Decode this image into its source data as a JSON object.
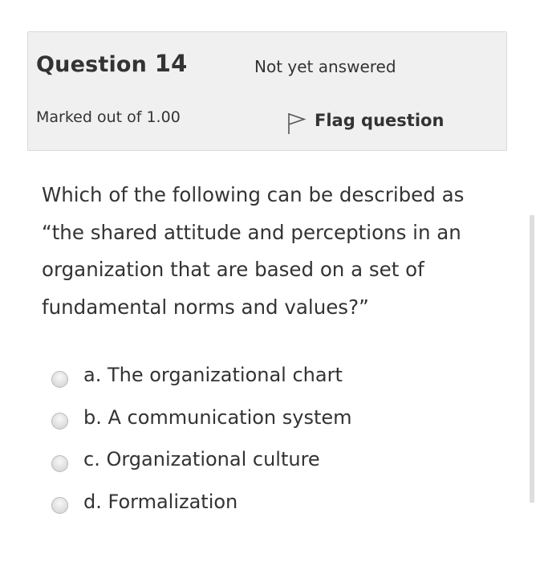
{
  "question": {
    "title_prefix": "Question",
    "number": "14",
    "state": "Not yet answered",
    "grade": "Marked out of 1.00",
    "flag_label": "Flag question",
    "text": "Which of the following can be described as “the shared attitude and perceptions in an organization that are based on a set of fundamental norms and values?”"
  },
  "answers": [
    {
      "label": "a. The organizational chart",
      "selected": false
    },
    {
      "label": "b. A communication system",
      "selected": false
    },
    {
      "label": "c. Organizational culture",
      "selected": false
    },
    {
      "label": "d. Formalization",
      "selected": false
    }
  ],
  "icons": {
    "flag": "flag-icon",
    "radio": "radio-icon"
  },
  "colors": {
    "info_background": "#f0f0f0",
    "text": "#333333"
  }
}
